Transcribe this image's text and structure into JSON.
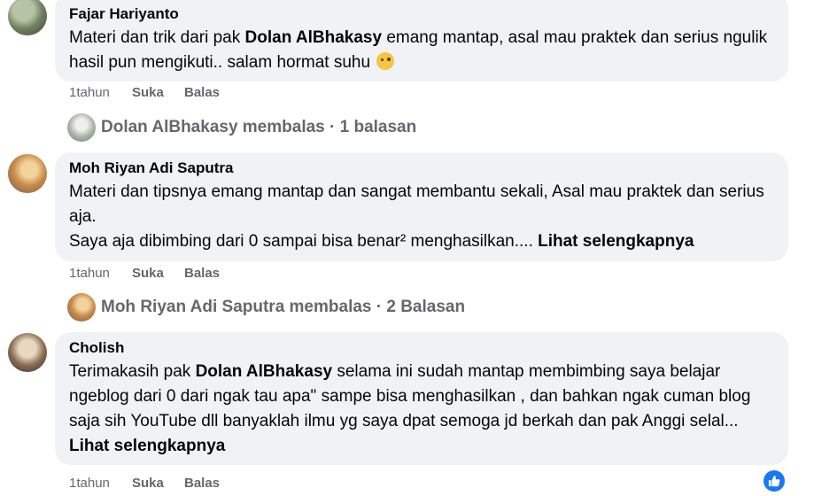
{
  "comments": [
    {
      "author": "Fajar Hariyanto",
      "text_before": "Materi dan trik dari pak ",
      "mention": "Dolan AlBhakasy",
      "text_after": " emang mantap, asal mau praktek dan serius ngulik hasil pun mengikuti.. salam hormat suhu",
      "time": "1tahun",
      "like_label": "Suka",
      "reply_label": "Balas",
      "replies_summary": "Dolan AlBhakasy membalas · 1 balasan"
    },
    {
      "author": "Moh Riyan Adi Saputra",
      "line1": "Materi dan tipsnya emang mantap dan sangat membantu sekali, Asal mau praktek dan serius aja.",
      "line2": "Saya aja dibimbing dari 0 sampai bisa benar² menghasilkan.... ",
      "see_more": "Lihat selengkapnya",
      "time": "1tahun",
      "like_label": "Suka",
      "reply_label": "Balas",
      "replies_summary": "Moh Riyan Adi Saputra membalas · 2 Balasan"
    },
    {
      "author": "Cholish",
      "text_before": "Terimakasih pak ",
      "mention": "Dolan AlBhakasy",
      "text_after": " selama ini sudah mantap membimbing saya belajar ngeblog dari 0 dari ngak tau apa\" sampe bisa menghasilkan , dan bahkan ngak cuman blog saja sih YouTube dll banyaklah ilmu yg saya dpat semoga jd berkah dan pak Anggi selal... ",
      "see_more": "Lihat selengkapnya",
      "time": "1tahun",
      "like_label": "Suka",
      "reply_label": "Balas"
    }
  ],
  "icons": {
    "emoji": "thinking-face-emoji-icon",
    "like_fab": "thumbs-up-icon"
  },
  "colors": {
    "bubble": "#f0f2f5",
    "meta": "#65676b",
    "accent": "#1877f2"
  }
}
